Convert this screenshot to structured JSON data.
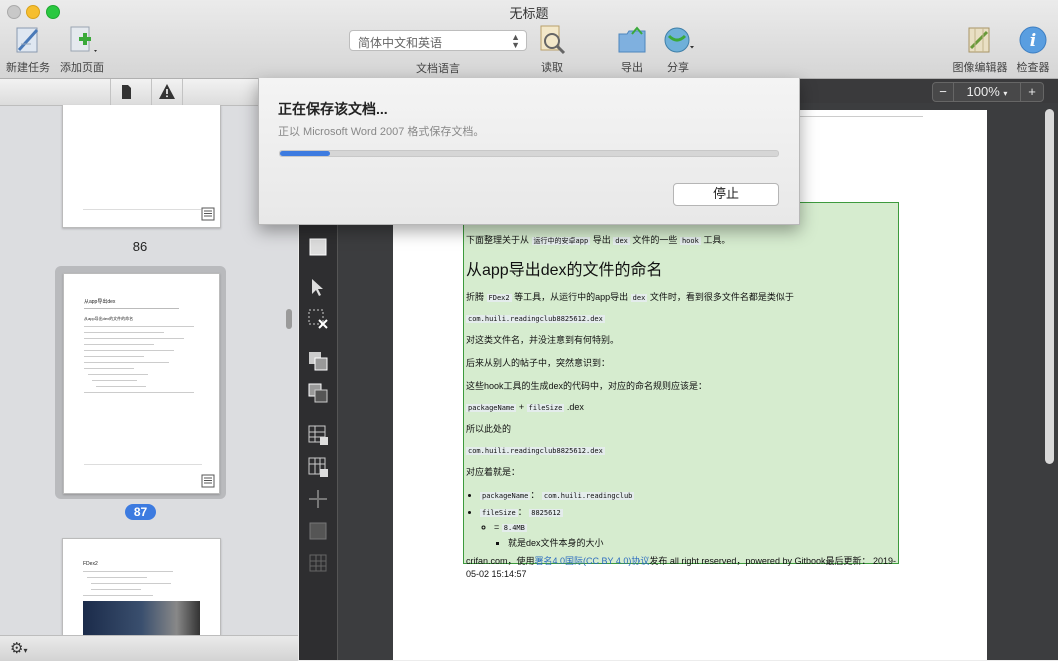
{
  "window": {
    "title": "无标题"
  },
  "toolbar": {
    "new_task": "新建任务",
    "add_page": "添加页面",
    "doc_language_value": "简体中文和英语",
    "doc_language_label": "文档语言",
    "read": "读取",
    "export": "导出",
    "share": "分享",
    "image_editor": "图像编辑器",
    "inspector": "检查器"
  },
  "sidebar": {
    "pages": [
      {
        "number": "86",
        "selected": false
      },
      {
        "number": "87",
        "selected": true
      }
    ],
    "thumb87": {
      "lines": [
        "从app导出dex",
        "从app导出dex的文件的命名"
      ]
    },
    "thumb88": {
      "heading": "FDex2"
    }
  },
  "zoom": {
    "minus": "−",
    "value": "100%",
    "plus": "+"
  },
  "document": {
    "intro_a": "下面整理关于从",
    "intro_code": "运行中的安卓app",
    "intro_b": "导出",
    "intro_code2": "dex",
    "intro_c": "文件的一些",
    "intro_code3": "hook",
    "intro_d": "工具。",
    "heading": "从app导出dex的文件的命名",
    "p1_a": "折腾",
    "p1_code": "FDex2",
    "p1_b": "等工具，从运行中的app导出",
    "p1_code2": "dex",
    "p1_c": "文件时，看到很多文件名都是类似于",
    "code_filename": "com.huili.readingclub8825612.dex",
    "p2": "对这类文件名，并没注意到有何特别。",
    "p3": "后来从别人的帖子中，突然意识到：",
    "p4": "这些hook工具的生成dex的代码中，对应的命名规则应该是：",
    "rule_code1": "packageName",
    "rule_plus": "+",
    "rule_code2": "fileSize",
    "rule_ext": ".dex",
    "p5": "所以此处的",
    "code_filename2": "com.huili.readingclub8825612.dex",
    "p6": "对应着就是：",
    "li1_code": "packageName",
    "li1_sep": "：",
    "li1_val": "com.huili.readingclub",
    "li2_code": "fileSize",
    "li2_sep": "：",
    "li2_val": "8825612",
    "li2_sub": "=",
    "li2_sub_code": "8.4MB",
    "li2_subsub": "就是dex文件本身的大小",
    "footer_a": "crifan.com，使用",
    "footer_link": "署名4.0国际(CC BY 4.0)协议",
    "footer_b": "发布 all right reserved，powered by Gitbook最后更新： 2019-05-02 15:14:57"
  },
  "dialog": {
    "title": "正在保存该文档...",
    "subtitle": "正以 Microsoft Word 2007 格式保存文档。",
    "progress": 0.1,
    "stop_label": "停止"
  },
  "colors": {
    "accent": "#3d7be0",
    "highlight_green": "#d6eccf",
    "page_badge": "#3d7be0"
  }
}
